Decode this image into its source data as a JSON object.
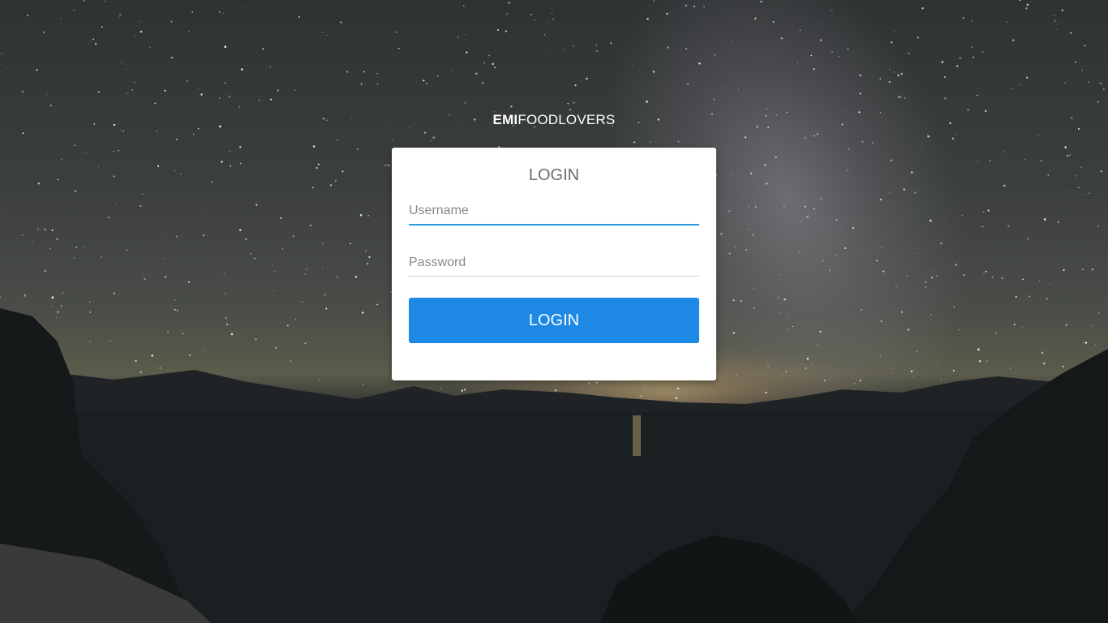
{
  "brand": {
    "bold": "EMI",
    "regular": "FOODLOVERS"
  },
  "login_card": {
    "title": "LOGIN",
    "username_placeholder": "Username",
    "username_value": "",
    "password_placeholder": "Password",
    "password_value": "",
    "submit_label": "LOGIN"
  },
  "colors": {
    "accent": "#1e88e5",
    "focus_underline": "#2a9bd8",
    "card_background": "#ffffff"
  }
}
